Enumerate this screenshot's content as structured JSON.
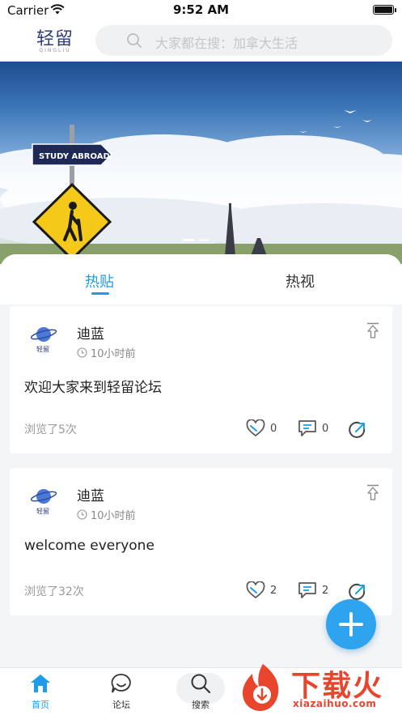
{
  "status_bar": {
    "carrier": "Carrier",
    "time": "9:52 AM"
  },
  "header": {
    "logo_cn": "轻留",
    "logo_en": "QINGLIU",
    "search_placeholder": "大家都在搜：加拿大生活"
  },
  "banner": {
    "sign_text": "STUDY ABROAD",
    "slide_count": 2,
    "active_slide": 0
  },
  "tabs": [
    {
      "label": "热贴",
      "active": true
    },
    {
      "label": "热视",
      "active": false
    }
  ],
  "posts": [
    {
      "avatar_text": "轻留",
      "author": "迪蓝",
      "time": "10小时前",
      "title": "欢迎大家来到轻留论坛",
      "views": "浏览了5次",
      "likes": "0",
      "comments": "0"
    },
    {
      "avatar_text": "轻留",
      "author": "迪蓝",
      "time": "10小时前",
      "title": "welcome everyone",
      "views": "浏览了32次",
      "likes": "2",
      "comments": "2"
    }
  ],
  "nav": [
    {
      "label": "首页",
      "icon": "home-icon",
      "active": true
    },
    {
      "label": "论坛",
      "icon": "forum-icon",
      "active": false
    },
    {
      "label": "搜索",
      "icon": "search-icon",
      "active": false
    }
  ],
  "watermark": {
    "text": "下载火",
    "url": "xiazaihuo.com"
  },
  "colors": {
    "accent": "#1e9bea",
    "fab": "#2fa4ee",
    "watermark": "#e8452c"
  }
}
